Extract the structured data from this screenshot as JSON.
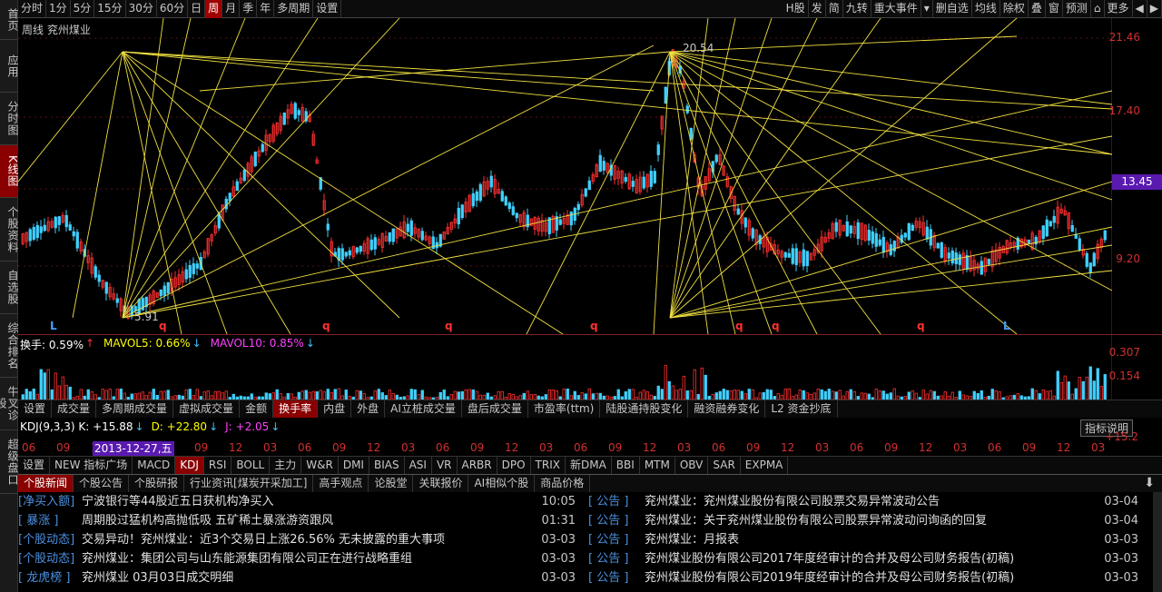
{
  "leftnav": [
    "首页",
    "应用",
    "分时图",
    "K线图",
    "个股资料",
    "自选股",
    "综合排名",
    "牛叉诊股",
    "超级盘口"
  ],
  "leftnav_active": 3,
  "toolbar": {
    "periods": [
      "分时",
      "1分",
      "5分",
      "15分",
      "30分",
      "60分",
      "日",
      "周",
      "月",
      "季",
      "年",
      "多周期",
      "设置"
    ],
    "active_period": 7,
    "right": [
      "H股",
      "发",
      "简",
      "九转",
      "重大事件",
      "▾",
      "删自选",
      "均线",
      "除权",
      "叠",
      "窗",
      "预测",
      "⌂",
      "更多",
      "◀",
      "▶"
    ]
  },
  "chart": {
    "title": "周线 兖州煤业",
    "prices": [
      "21.46",
      "17.40",
      "13.45",
      "9.20"
    ],
    "badge": "13.45",
    "high_label": "20.54",
    "low_label": "5.91",
    "markers": [
      "L",
      "q",
      "q",
      "q",
      "q",
      "q",
      "q",
      "q",
      "L"
    ]
  },
  "volume": {
    "legend": [
      {
        "label": "换手: 0.59%",
        "arrow": "↑",
        "color": "#ffffff",
        "arrow_color": "#ff3030"
      },
      {
        "label": "MAVOL5: 0.66%",
        "arrow": "↓",
        "color": "#ffff00",
        "arrow_color": "#40c0ff"
      },
      {
        "label": "MAVOL10: 0.85%",
        "arrow": "↓",
        "color": "#ff40ff",
        "arrow_color": "#40c0ff"
      }
    ],
    "scale": [
      "0.307",
      "0.154"
    ]
  },
  "tabs1": [
    "设置",
    "成交量",
    "多周期成交量",
    "虚拟成交量",
    "金额",
    "换手率",
    "内盘",
    "外盘",
    "AI立桩成交量",
    "盘后成交量",
    "市盈率(ttm)",
    "陆股通持股变化",
    "融资融券变化",
    "L2 资金抄底"
  ],
  "tabs1_active": 5,
  "kdj": {
    "legend": [
      {
        "label": "KDJ(9,3,3) K: +15.88",
        "arrow": "↓",
        "color": "#ffffff"
      },
      {
        "label": "D: +22.80",
        "arrow": "↓",
        "color": "#ffff00"
      },
      {
        "label": "J: +2.05",
        "arrow": "↓",
        "color": "#ff40ff"
      }
    ],
    "explain": "指标说明",
    "right_value": "+15.2",
    "cursor_date": "2013-12-27,五",
    "date_ticks": [
      "06",
      "09",
      "12",
      "03",
      "06",
      "09",
      "12",
      "03",
      "06",
      "09",
      "12",
      "03",
      "06",
      "09",
      "12",
      "03",
      "06",
      "09",
      "12",
      "03",
      "06",
      "09",
      "12",
      "03",
      "06",
      "09",
      "12",
      "03",
      "06",
      "09",
      "12",
      "03"
    ]
  },
  "tabs2": [
    "设置",
    "NEW 指标广场",
    "MACD",
    "KDJ",
    "RSI",
    "BOLL",
    "主力",
    "W&R",
    "DMI",
    "BIAS",
    "ASI",
    "VR",
    "ARBR",
    "DPO",
    "TRIX",
    "新DMA",
    "BBI",
    "MTM",
    "OBV",
    "SAR",
    "EXPMA"
  ],
  "tabs2_active": 3,
  "newstabs": [
    "个股新闻",
    "个股公告",
    "个股研报",
    "行业资讯[煤炭开采加工]",
    "高手观点",
    "论股堂",
    "关联报价",
    "AI相似个股",
    "商品价格"
  ],
  "newstabs_active": 0,
  "news_left": [
    {
      "tag": "[净买入额]",
      "text": "宁波银行等44股近五日获机构净买入",
      "time": "10:05"
    },
    {
      "tag": "[  暴涨  ]",
      "text": "周期股过猛机构高抛低吸 五矿稀土暴涨游资跟风",
      "time": "01:31"
    },
    {
      "tag": "[个股动态]",
      "text": "交易异动！兖州煤业：近3个交易日上涨26.56% 无未披露的重大事项",
      "time": "03-03"
    },
    {
      "tag": "[个股动态]",
      "text": "兖州煤业：集团公司与山东能源集团有限公司正在进行战略重组",
      "time": "03-03"
    },
    {
      "tag": "[ 龙虎榜 ]",
      "text": "兖州煤业 03月03日成交明细",
      "time": "03-03"
    }
  ],
  "news_right": [
    {
      "tag": "[  公告  ]",
      "text": "兖州煤业：兖州煤业股份有限公司股票交易异常波动公告",
      "time": "03-04"
    },
    {
      "tag": "[  公告  ]",
      "text": "兖州煤业：关于兖州煤业股份有限公司股票异常波动问询函的回复",
      "time": "03-04"
    },
    {
      "tag": "[  公告  ]",
      "text": "兖州煤业：月报表",
      "time": "03-03"
    },
    {
      "tag": "[  公告  ]",
      "text": "兖州煤业股份有限公司2017年度经审计的合并及母公司财务报告(初稿)",
      "time": "03-03"
    },
    {
      "tag": "[  公告  ]",
      "text": "兖州煤业股份有限公司2019年度经审计的合并及母公司财务报告(初稿)",
      "time": "03-03"
    }
  ]
}
